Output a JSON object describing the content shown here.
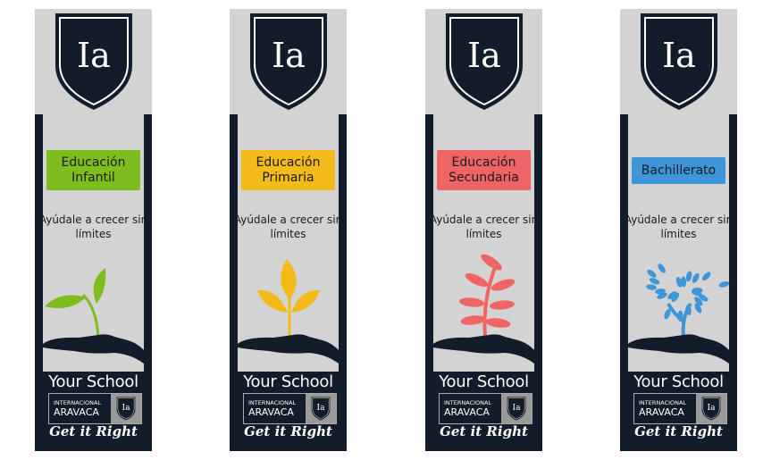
{
  "brand": {
    "monogram": "Ia",
    "your_school": "Your School",
    "logo_small": "INTERNACIONAL",
    "logo_big": "ARAVACA",
    "slogan": "Get it Right"
  },
  "colors": {
    "navy": "#131c2a",
    "gray": "#d3d3d3"
  },
  "banners": [
    {
      "label": "Educación Infantil",
      "tagline": "Ayúdale a crecer sin límites",
      "color": "#7dbd1e",
      "plant": "sprout-icon"
    },
    {
      "label": "Educación Primaria",
      "tagline": "Ayúdale a crecer sin límites",
      "color": "#f2bb1a",
      "plant": "seedling-icon"
    },
    {
      "label": "Educación Secundaria",
      "tagline": "Ayúdale a crecer sin límites",
      "color": "#ef6464",
      "plant": "plant-icon"
    },
    {
      "label": "Bachillerato",
      "tagline": "Ayúdale a crecer sin límites",
      "color": "#3d96d8",
      "plant": "tree-icon"
    }
  ]
}
